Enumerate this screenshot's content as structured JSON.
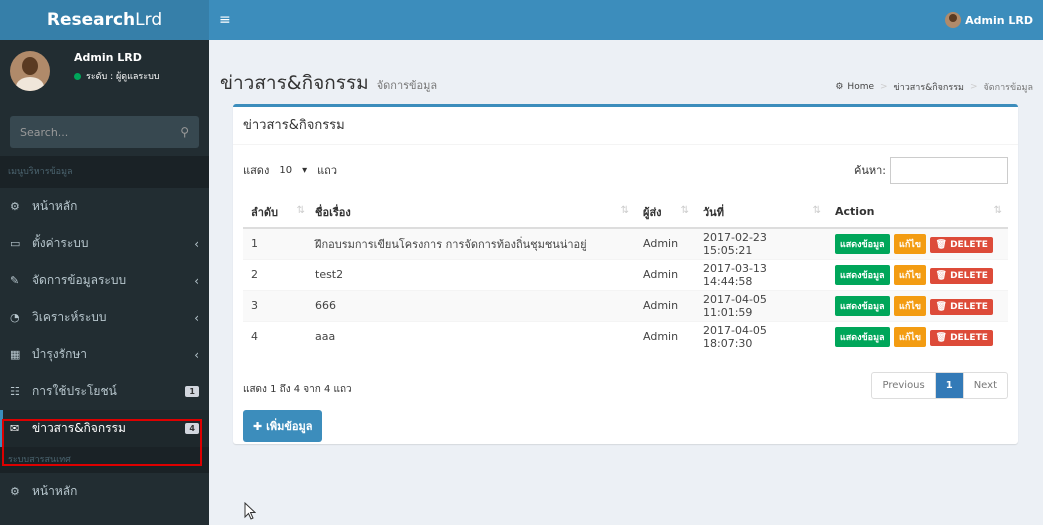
{
  "brand": {
    "bold": "Research",
    "light": "Lrd"
  },
  "user": {
    "name": "Admin LRD",
    "status": "ระดับ : ผู้ดูแลระบบ"
  },
  "search": {
    "placeholder": "Search..."
  },
  "sidebar": {
    "header_main": "เมนูบริหารข้อมูล",
    "items": [
      {
        "label": "หน้าหลัก",
        "icon": "dashboard-icon"
      },
      {
        "label": "ตั้งค่าระบบ",
        "icon": "laptop-icon",
        "chevron": "‹"
      },
      {
        "label": "จัดการข้อมูลระบบ",
        "icon": "edit-icon",
        "chevron": "‹"
      },
      {
        "label": "วิเคราะห์ระบบ",
        "icon": "pie-chart-icon",
        "chevron": "‹"
      },
      {
        "label": "บำรุงรักษา",
        "icon": "table-icon",
        "chevron": "‹"
      },
      {
        "label": "การใช้ประโยชน์",
        "icon": "calendar-icon",
        "badge": "1"
      },
      {
        "label": "ข่าวสาร&กิจกรรม",
        "icon": "envelope-icon",
        "badge": "4"
      }
    ],
    "header_info": "ระบบสารสนเทศ",
    "info_items": [
      {
        "label": "หน้าหลัก",
        "icon": "dashboard-icon"
      }
    ]
  },
  "topbar": {
    "menu_glyph": "≡",
    "user": "Admin LRD"
  },
  "page": {
    "title": "ข่าวสาร&กิจกรรม",
    "subtitle": "จัดการข้อมูล"
  },
  "breadcrumb": {
    "home": "Home",
    "section": "ข่าวสาร&กิจกรรม",
    "current": "จัดการข้อมูล"
  },
  "box": {
    "title": "ข่าวสาร&กิจกรรม"
  },
  "table_controls": {
    "show_label": "แสดง",
    "length": "10",
    "length_suffix": "แถว",
    "search_label": "ค้นหา:"
  },
  "table": {
    "headers": [
      "ลำดับ",
      "ชื่อเรื่อง",
      "ผู้ส่ง",
      "วันที่",
      "Action"
    ],
    "rows": [
      {
        "no": "1",
        "title": "ฝึกอบรมการเขียนโครงการ การจัดการท้องถิ่นชุมชนน่าอยู่",
        "sender": "Admin",
        "date": "2017-02-23 15:05:21"
      },
      {
        "no": "2",
        "title": "test2",
        "sender": "Admin",
        "date": "2017-03-13 14:44:58"
      },
      {
        "no": "3",
        "title": "666",
        "sender": "Admin",
        "date": "2017-04-05 11:01:59"
      },
      {
        "no": "4",
        "title": "aaa",
        "sender": "Admin",
        "date": "2017-04-05 18:07:30"
      }
    ],
    "actions": {
      "view": "แสดงข้อมูล",
      "edit": "แก้ไข",
      "delete": "DELETE"
    }
  },
  "pagination": {
    "info": "แสดง 1 ถึง 4 จาก 4 แถว",
    "previous": "Previous",
    "page": "1",
    "next": "Next"
  },
  "add_button": "เพิ่มข้อมูล",
  "colors": {
    "primary": "#3c8dbc",
    "sidebar": "#222d32",
    "green": "#00a65a",
    "orange": "#f39c12",
    "red": "#dd4b39"
  }
}
